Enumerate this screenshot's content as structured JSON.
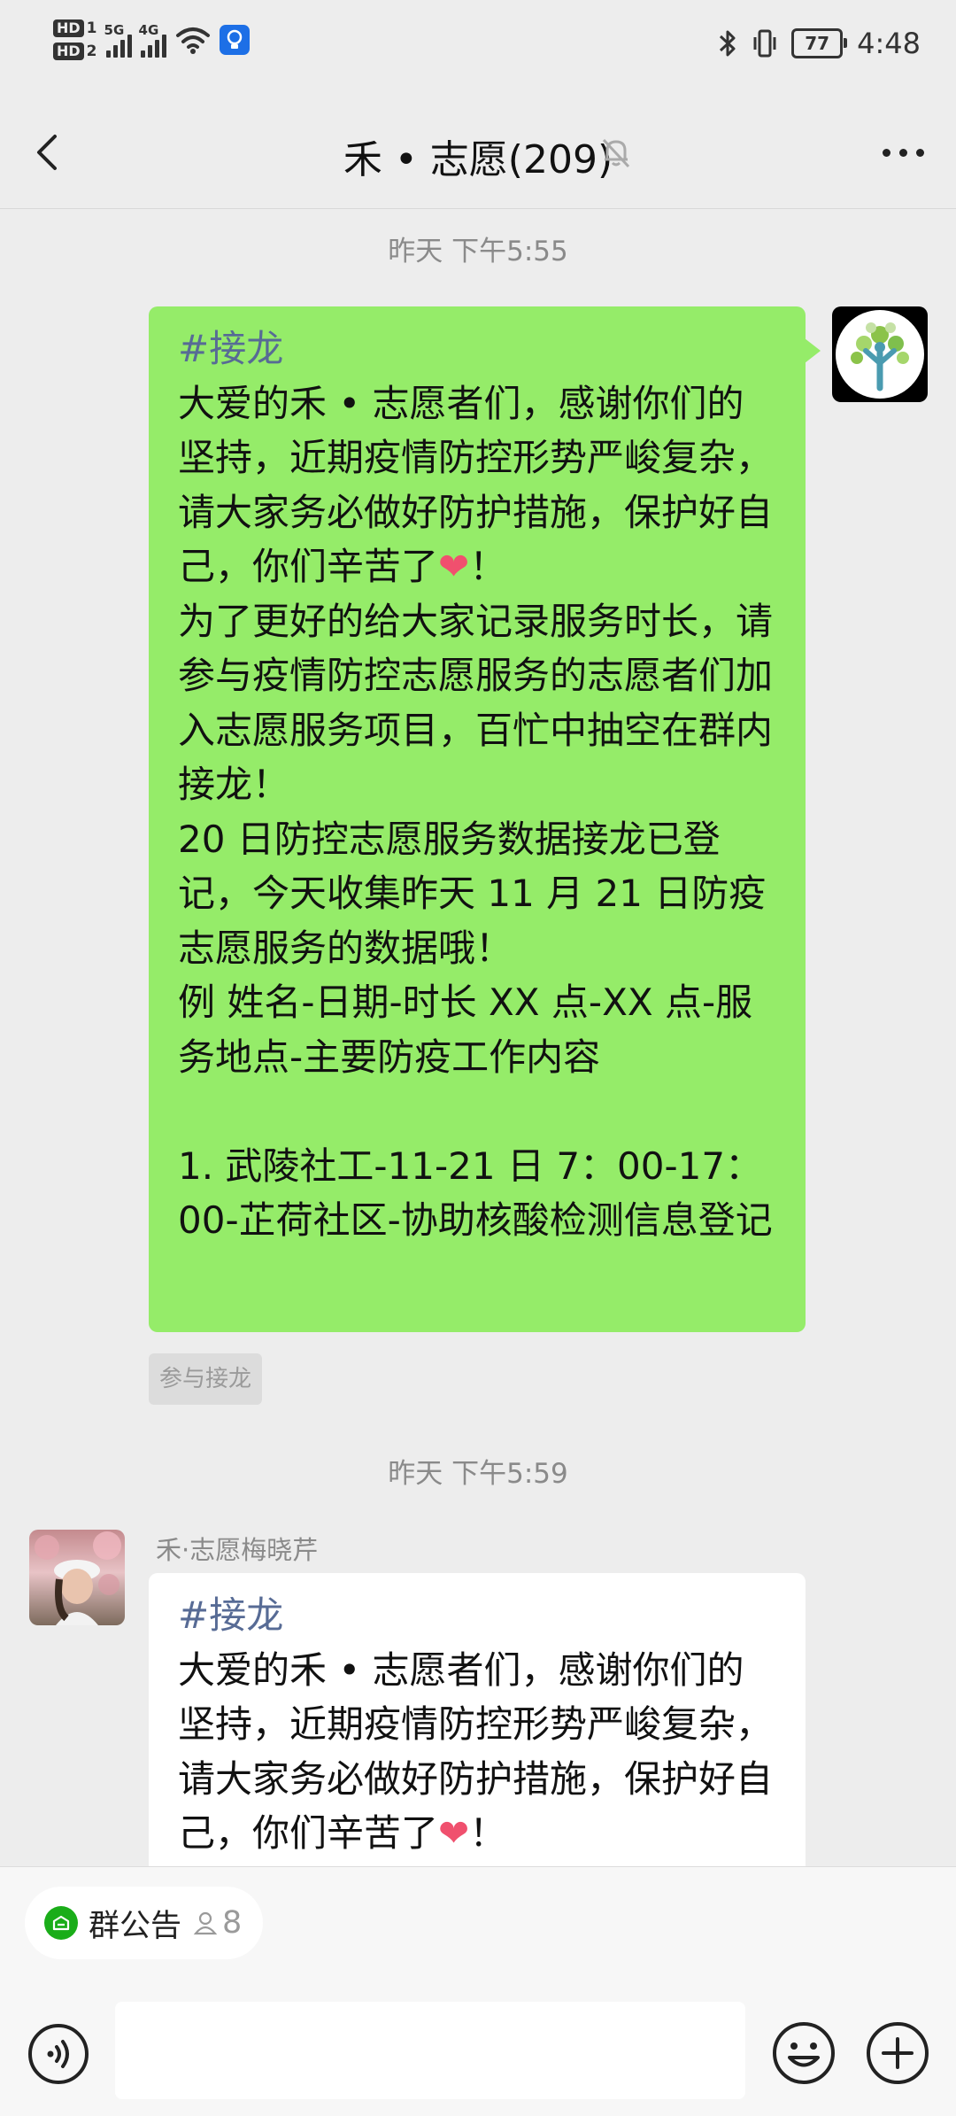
{
  "status_bar": {
    "hd1": "HD",
    "hd1_num": "1",
    "hd2": "HD",
    "hd2_num": "2",
    "net1": "5G",
    "net2": "4G",
    "battery": "77",
    "time": "4:48"
  },
  "nav": {
    "title": "禾 • 志愿(209)"
  },
  "chat": {
    "time1": "昨天 下午5:55",
    "msg1": {
      "tag": "#接龙",
      "body_before_heart": "大爱的禾 • 志愿者们，感谢你们的坚持，近期疫情防控形势严峻复杂，请大家务必做好防护措施，保护好自己，你们辛苦了",
      "heart": "❤",
      "body_after_heart": "！\n为了更好的给大家记录服务时长，请参与疫情防控志愿服务的志愿者们加入志愿服务项目，百忙中抽空在群内接龙！\n20 日防控志愿服务数据接龙已登记，今天收集昨天 11 月 21 日防疫志愿服务的数据哦！\n例 姓名-日期-时长 XX 点-XX 点-服务地点-主要防疫工作内容\n\n1. 武陵社工-11-21 日 7：00-17：00-芷荷社区-协助核酸检测信息登记"
    },
    "join_label": "参与接龙",
    "time2": "昨天 下午5:59",
    "msg2": {
      "sender": "禾·志愿梅晓芹",
      "tag": "#接龙",
      "body_before_heart": "大爱的禾 • 志愿者们，感谢你们的坚持，近期疫情防控形势严峻复杂，请大家务必做好防护措施，保护好自己，你们辛苦了",
      "heart": "❤",
      "body_after_heart": "！"
    }
  },
  "bottom_bar": {
    "notice_label": "群公告",
    "notice_count": "8",
    "input_value": ""
  },
  "icons": {
    "back": "chevron-left-icon",
    "mute": "bell-off-icon",
    "more": "more-dots-icon",
    "voice": "voice-icon",
    "emoji": "emoji-icon",
    "plus": "plus-icon",
    "notice": "announcement-icon",
    "member": "person-icon"
  },
  "colors": {
    "background": "#ededed",
    "own_bubble": "#95ec69",
    "other_bubble": "#ffffff",
    "tag": "#576b95",
    "accent": "#1aad19"
  }
}
